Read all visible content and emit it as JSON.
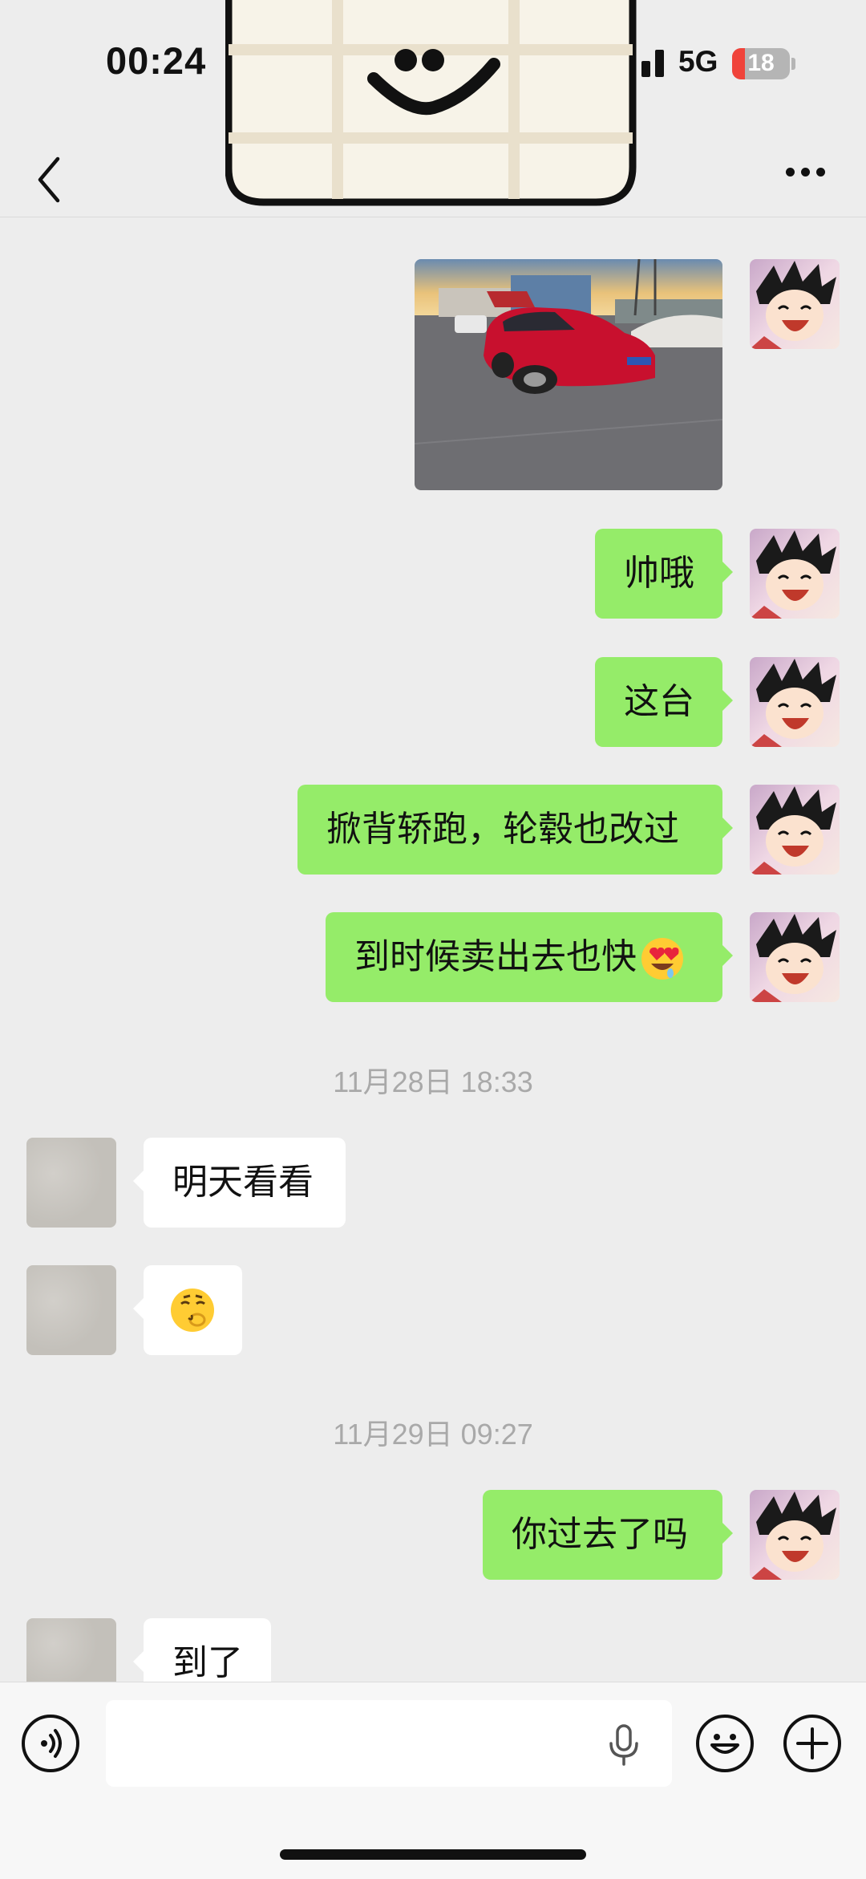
{
  "status_bar": {
    "time": "00:24",
    "network": "5G",
    "battery": "18"
  },
  "messages": [
    {
      "sender": "me",
      "type": "image",
      "description_icon": "car-photo"
    },
    {
      "sender": "me",
      "type": "text",
      "text": "帅哦"
    },
    {
      "sender": "me",
      "type": "text",
      "text": "这台"
    },
    {
      "sender": "me",
      "type": "text",
      "text": "掀背轿跑，轮毂也改过"
    },
    {
      "sender": "me",
      "type": "text",
      "text": "到时候卖出去也快"
    },
    {
      "type": "timestamp",
      "text": "11月28日 18:33"
    },
    {
      "sender": "other",
      "type": "text",
      "text": "明天看看"
    },
    {
      "sender": "other",
      "type": "emoji",
      "icon": "smirk-shush-emoji"
    },
    {
      "type": "timestamp",
      "text": "11月29日 09:27"
    },
    {
      "sender": "me",
      "type": "text",
      "text": "你过去了吗"
    },
    {
      "sender": "other",
      "type": "text",
      "text": "到了"
    }
  ],
  "icons": {
    "back": "chevron-left-icon",
    "more": "more-dots-icon",
    "voice": "voice-icon",
    "mic": "microphone-icon",
    "emoji": "emoji-icon",
    "plus": "plus-icon",
    "heart_eyes": "heart-eyes-emoji"
  },
  "colors": {
    "my_bubble": "#95ec69",
    "their_bubble": "#ffffff",
    "background": "#ededed"
  }
}
